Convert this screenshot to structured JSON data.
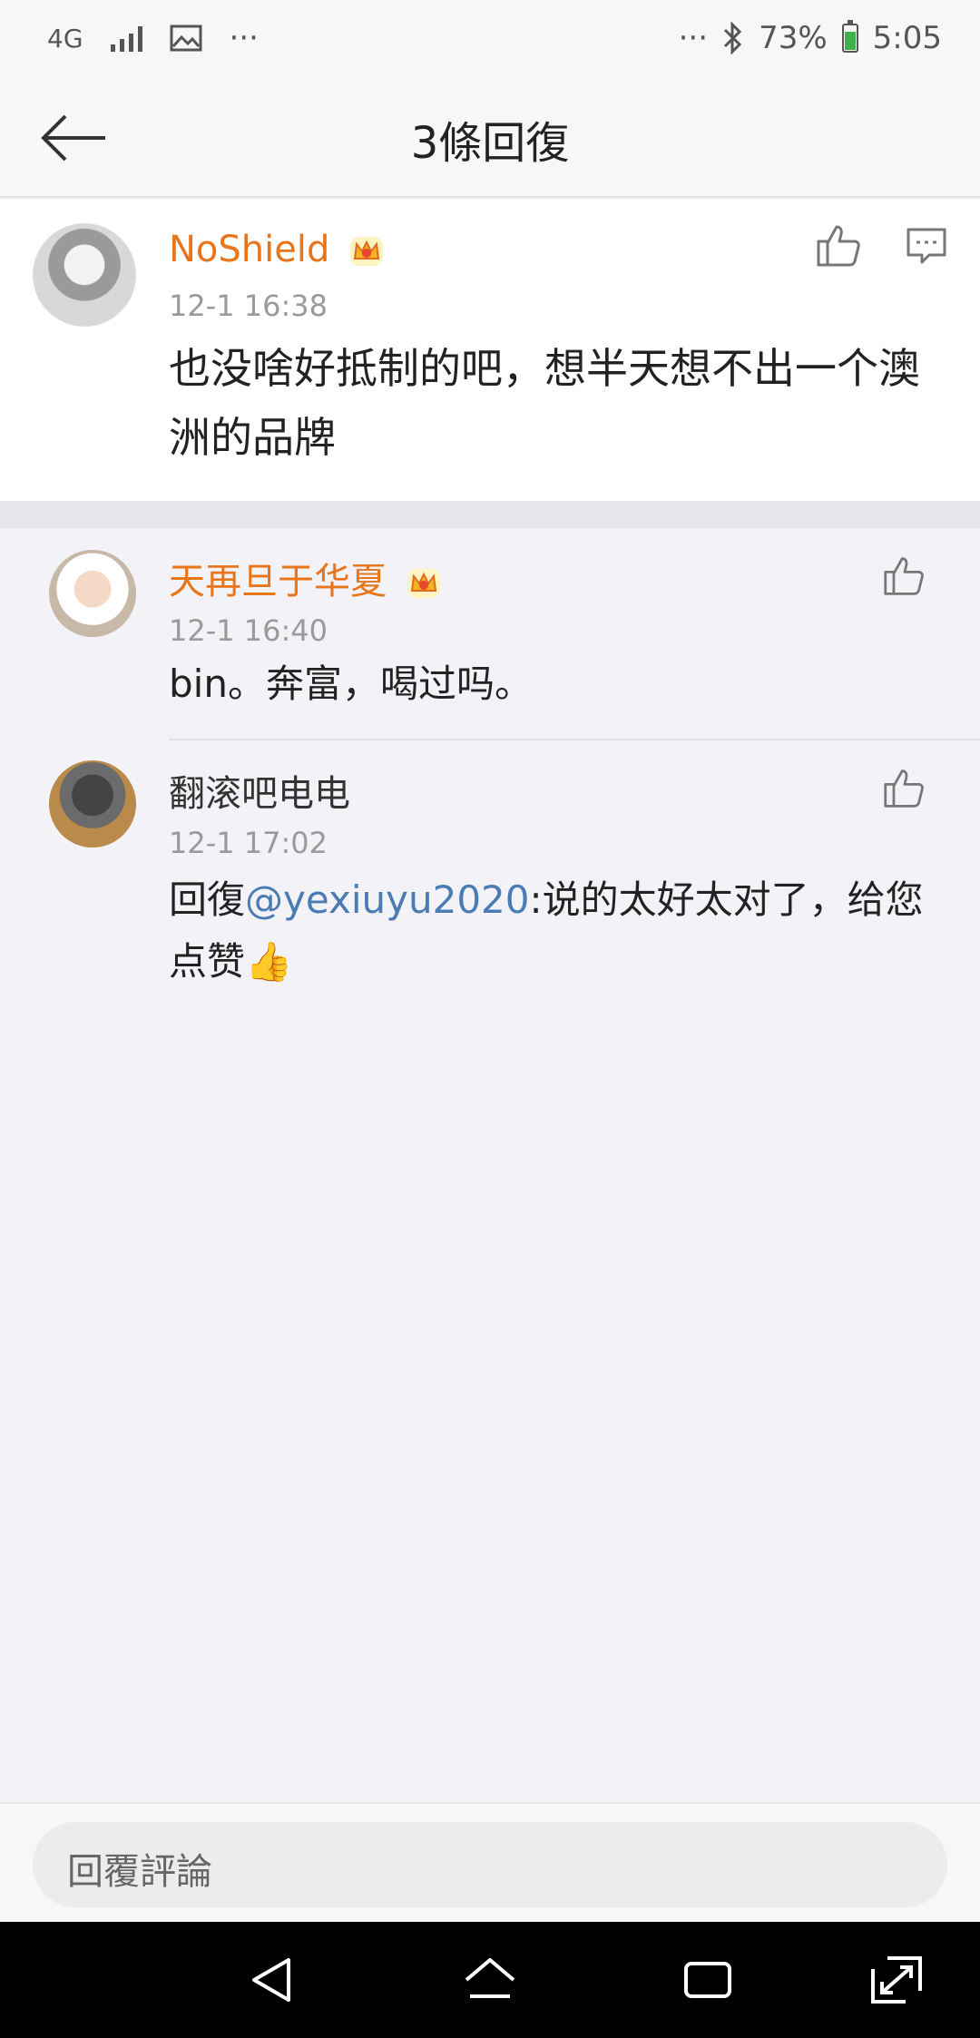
{
  "status_bar": {
    "network": "4G",
    "more_left": "···",
    "more_right": "···",
    "battery": "73%",
    "time": "5:05"
  },
  "header": {
    "title": "3條回復"
  },
  "root_comment": {
    "username": "NoShield",
    "time": "12-1 16:38",
    "text": "也没啥好抵制的吧，想半天想不出一个澳洲的品牌"
  },
  "replies": [
    {
      "username": "天再旦于华夏",
      "time": "12-1 16:40",
      "text": "bin。奔富，喝过吗。"
    },
    {
      "username": "翻滚吧电电",
      "time": "12-1 17:02",
      "prefix": "回復",
      "mention": "@yexiuyu2020",
      "text": ":说的太好太对了，给您点赞👍"
    }
  ],
  "input": {
    "placeholder": "回覆評論"
  },
  "colors": {
    "vip_name": "#e8751a",
    "mention": "#4a7bb3",
    "time_gray": "#9a9a9a"
  },
  "icons": [
    "signal-icon",
    "image-icon",
    "bluetooth-icon",
    "battery-icon",
    "back-arrow-icon",
    "crown-icon",
    "like-icon",
    "comment-icon",
    "nav-back-icon",
    "nav-home-icon",
    "nav-recents-icon",
    "nav-expand-icon"
  ]
}
